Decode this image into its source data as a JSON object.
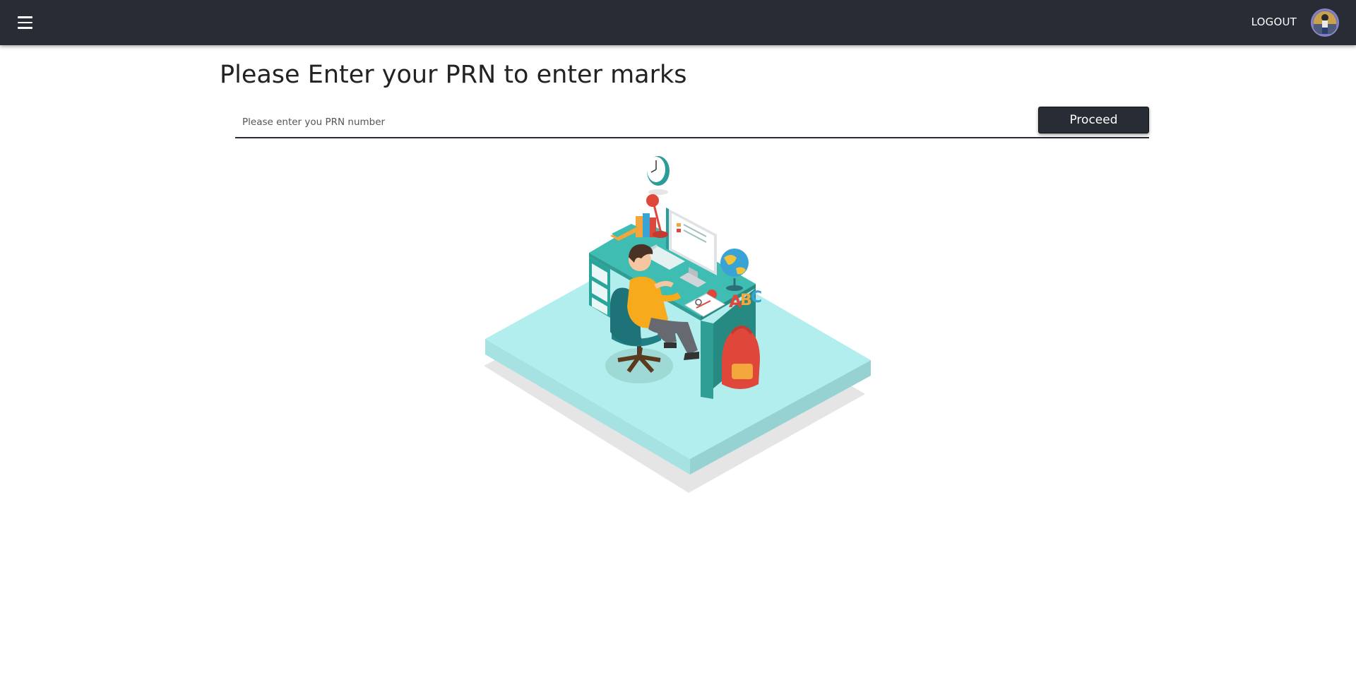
{
  "header": {
    "menu_icon": "hamburger-menu-icon",
    "logout_label": "LOGOUT",
    "avatar_icon": "user-avatar"
  },
  "main": {
    "title": "Please Enter your PRN to enter marks",
    "prn_input": {
      "value": "",
      "placeholder": "Please enter you PRN number"
    },
    "proceed_label": "Proceed",
    "illustration": "student-at-desk-illustration"
  },
  "colors": {
    "topbar": "#282c35",
    "button": "#282c35",
    "platform": "#b3eeee",
    "desk": "#3fbdb3"
  }
}
